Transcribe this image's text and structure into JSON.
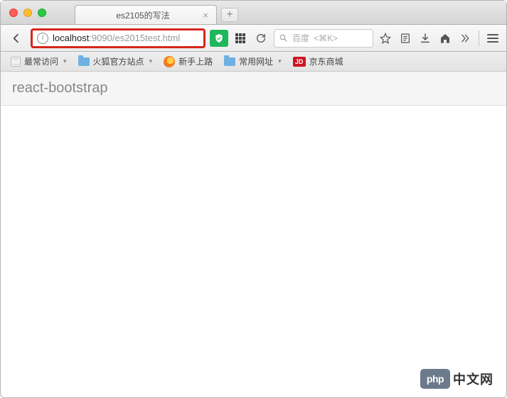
{
  "window": {
    "tab_title": "es2105的写法"
  },
  "address_bar": {
    "url_host": "localhost",
    "url_port": ":9090",
    "url_path": "/es2015test.html"
  },
  "search": {
    "engine": "百度",
    "shortcut": "<⌘K>"
  },
  "bookmarks": {
    "most_visited": "最常访问",
    "firefox_sites": "火狐官方站点",
    "new_user": "新手上路",
    "common_urls": "常用网址",
    "jd_label": "JD",
    "jd_text": "京东商城"
  },
  "page": {
    "heading": "react-bootstrap"
  },
  "watermark": {
    "logo_text": "php",
    "brand_text": "中文网"
  }
}
